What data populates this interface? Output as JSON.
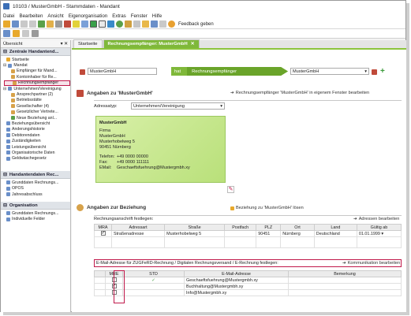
{
  "window": {
    "title": "10103 / MusterGmbH - Stammdaten - Mandant"
  },
  "menu": [
    "Datei",
    "Bearbeiten",
    "Ansicht",
    "Eigenorganisation",
    "Extras",
    "Fenster",
    "Hilfe"
  ],
  "toolbar": {
    "feedback_label": "Feedback geben"
  },
  "sidebar": {
    "top_label": "Übersicht",
    "section1": "Zentrale Handantend...",
    "items1": [
      "Startseite",
      "Mandat",
      "Empfänger für Mand...",
      "Kontoinhaber für Re...",
      "Rechnungsempfänger",
      "Unternehmen/Vereinigung",
      "Ansprechpartner (2)",
      "Betriebsstätte",
      "Gesellschafter (4)",
      "Gesetzlicher Vertrete...",
      "Neue Beziehung anl...",
      "Beziehungsübersicht",
      "Änderungshistorie",
      "Debitorendaten",
      "Zuständigkeiten",
      "Leistungsübersicht",
      "Organisatorische Daten",
      "Geldwäschegesetz"
    ],
    "section2": "Handantendaten Rec...",
    "items2": [
      "Grunddaten Rechnungs...",
      "OPOS",
      "Jahresabschluss"
    ],
    "section3": "Organisation",
    "items3": [
      "Grunddaten Rechnungs...",
      "Individuelle Felder"
    ]
  },
  "tabs": [
    "Startseite",
    "Rechnungsempfänger: MusterGmbH"
  ],
  "relation": {
    "left_field": "MusterGmbH",
    "hat_label": "hat",
    "relation_label": "Rechnungsempfänger",
    "right_field": "MusterGmbH"
  },
  "section_info": {
    "title": "Angaben zu 'MusterGmbH'",
    "open_window_link": "Rechnungsempfänger 'MusterGmbH' in eigenem Fenster bearbeiten",
    "adressatyp_label": "Adressatyp:",
    "adressatyp_value": "Unternehmen/Vereinigung"
  },
  "card": {
    "name": "MusterGmbH",
    "lines": [
      "Firma",
      "MusterGmbH",
      "Musterhobelweg 5",
      "90451 Nürnberg"
    ],
    "phone_label": "Telefon:",
    "phone": "+49 0000 00000",
    "fax_label": "Fax:",
    "fax": "+49 0000 111111",
    "email_label": "EMail:",
    "email": "Geschaeftsfuehrung@Mustergmbh.xy"
  },
  "section_relation": {
    "title": "Angaben zur Beziehung",
    "dissolve_link": "Beziehung zu 'MusterGmbH' lösen",
    "address_label": "Rechnungsanschrift festlegen:",
    "edit_addresses_link": "Adressen bearbeiten"
  },
  "address_table": {
    "headers": [
      "MRA",
      "Adressart",
      "Straße",
      "Postfach",
      "PLZ",
      "Ort",
      "Land",
      "Gültig ab"
    ],
    "rows": [
      {
        "mra": true,
        "adressart": "Straßenadresse",
        "strasse": "Musterhobelweg 5",
        "postfach": "",
        "plz": "90451",
        "ort": "Nürnberg",
        "land": "Deutschland",
        "gueltig": "01.01.1999"
      }
    ]
  },
  "email_section": {
    "label": "E-Mail-Adresse für ZUGFeRD-Rechnung / Digitalen Rechnungsversand / E-Rechnung festlegen:",
    "edit_link": "Kommunikation bearbeiten",
    "headers": [
      "MRE",
      "STD",
      "E-Mail-Adresse",
      "Bemerkung"
    ],
    "rows": [
      {
        "mre": false,
        "std": true,
        "email": "Geschaeftsfuehrung@Mustergmbh.xy"
      },
      {
        "mre": true,
        "std": false,
        "email": "Buchhaltung@Mustergmbh.xy"
      },
      {
        "mre": false,
        "std": false,
        "email": "Info@Mustergmbh.xy"
      }
    ]
  },
  "colors": {
    "accent": "#7fb83a",
    "highlight": "#c0184a"
  }
}
